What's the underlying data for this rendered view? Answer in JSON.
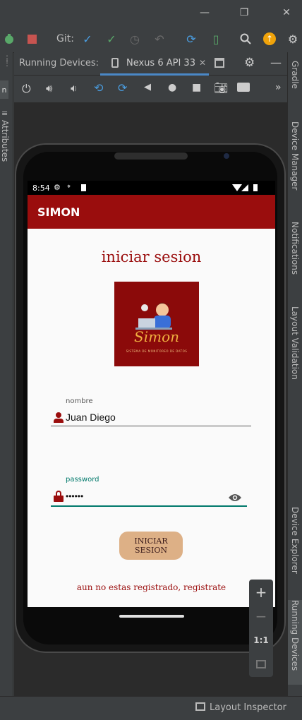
{
  "toolbar": {
    "git_label": "Git:"
  },
  "tabs": {
    "running_devices_label": "Running Devices:",
    "device_tab_label": "Nexus 6 API 33"
  },
  "left_panel": {
    "attributes_label": "Attributes",
    "partial_label": "n"
  },
  "right_panel": {
    "gradle_label": "Gradle",
    "device_manager_label": "Device Manager",
    "notifications_label": "Notifications",
    "layout_validation_label": "Layout Validation",
    "device_explorer_label": "Device Explorer",
    "running_devices_label": "Running Devices"
  },
  "statusbar": {
    "layout_inspector_label": "Layout Inspector"
  },
  "zoom": {
    "zoom_in": "+",
    "zoom_out": "−",
    "one_to_one": "1:1"
  },
  "phone": {
    "time": "8:54",
    "app_title": "SIMON",
    "page_title": "iniciar sesion",
    "logo_text": "Simon",
    "logo_subtitle": "SISTEMA DE MONITOREO DE DATOS",
    "nombre_label": "nombre",
    "nombre_value": "Juan Diego",
    "password_label": "password",
    "password_value": "••••••",
    "login_button": "INICIAR SESION",
    "register_link": "aun no estas registrado, registrate"
  },
  "colors": {
    "app_bar": "#9a0d0d",
    "accent_teal": "#00796b",
    "button": "#ddb086",
    "ide_background": "#3c3f41"
  }
}
